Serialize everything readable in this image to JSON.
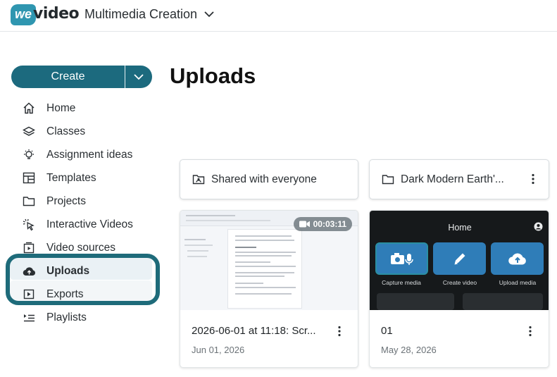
{
  "header": {
    "logo_we": "we",
    "logo_video": "video",
    "workspace": "Multimedia Creation"
  },
  "sidebar": {
    "create_label": "Create",
    "items": [
      {
        "label": "Home",
        "icon": "home-icon"
      },
      {
        "label": "Classes",
        "icon": "layers-icon"
      },
      {
        "label": "Assignment ideas",
        "icon": "lightbulb-icon"
      },
      {
        "label": "Templates",
        "icon": "templates-icon"
      },
      {
        "label": "Projects",
        "icon": "folder-icon"
      },
      {
        "label": "Interactive Videos",
        "icon": "cursor-click-icon"
      },
      {
        "label": "Video sources",
        "icon": "video-source-icon"
      },
      {
        "label": "Uploads",
        "icon": "cloud-upload-icon",
        "active": true
      },
      {
        "label": "Exports",
        "icon": "export-icon"
      },
      {
        "label": "Playlists",
        "icon": "playlist-icon"
      }
    ]
  },
  "main": {
    "title": "Uploads",
    "folders": [
      {
        "label": "Shared with everyone",
        "icon": "shared-folder-icon"
      },
      {
        "label": "Dark Modern Earth'...",
        "icon": "folder-icon"
      }
    ],
    "media": [
      {
        "title": "2026-06-01 at 11:18: Scr...",
        "date": "Jun 01, 2026",
        "duration": "00:03:11"
      },
      {
        "title": "01",
        "date": "May 28, 2026"
      }
    ],
    "app_preview": {
      "home": "Home",
      "tiles": [
        "Capture media",
        "Create video",
        "Upload media"
      ]
    }
  },
  "colors": {
    "brand": "#1c6a7e",
    "logo": "#2f96b0",
    "highlight": "#1e6b7a",
    "tile": "#2f7db8"
  }
}
